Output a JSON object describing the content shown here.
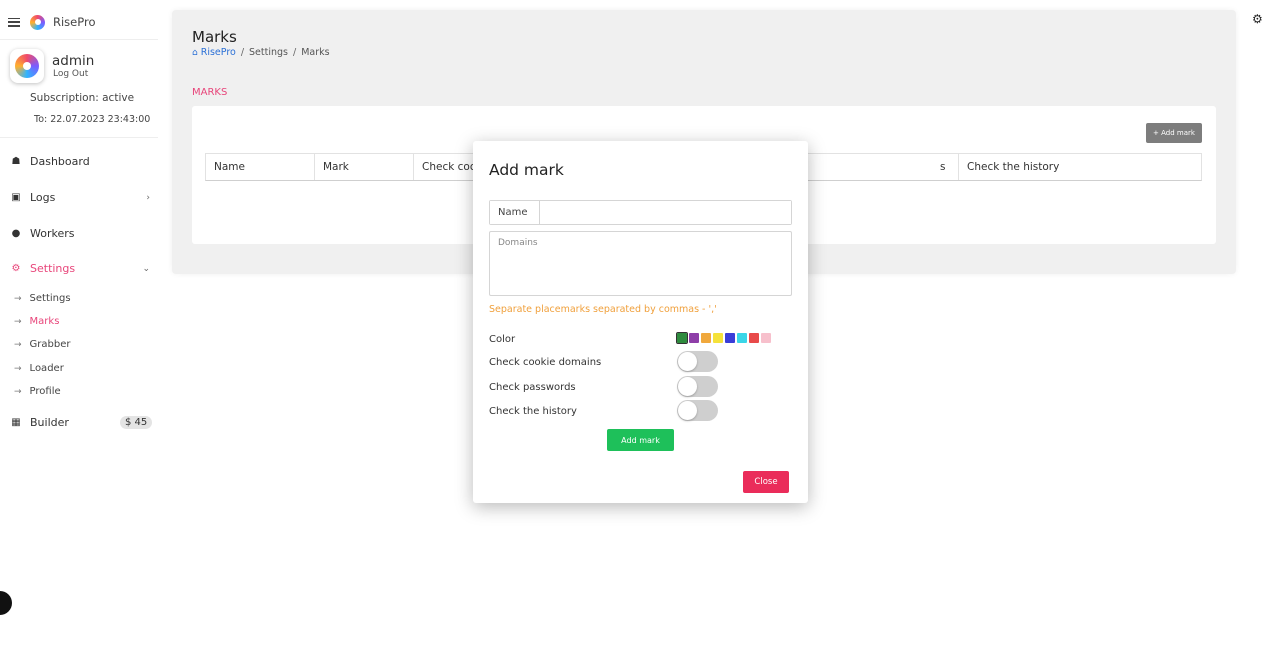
{
  "app": {
    "name": "RisePro"
  },
  "user": {
    "name": "admin",
    "logout_label": "Log Out",
    "subscription": "Subscription: active",
    "valid_to": "To: 22.07.2023 23:43:00"
  },
  "sidebar": {
    "items": [
      {
        "label": "Dashboard",
        "icon": "home-icon"
      },
      {
        "label": "Logs",
        "icon": "layers-icon"
      },
      {
        "label": "Workers",
        "icon": "users-icon"
      },
      {
        "label": "Settings",
        "icon": "gear-icon"
      },
      {
        "label": "Builder",
        "icon": "box-icon"
      }
    ],
    "settings_subitems": [
      "Settings",
      "Marks",
      "Grabber",
      "Loader",
      "Profile"
    ],
    "builder_badge": "$ 45",
    "accent_color": "#e8457a"
  },
  "page": {
    "title": "Marks",
    "breadcrumb": [
      "RisePro",
      "Settings",
      "Marks"
    ],
    "section_label": "MARKS",
    "add_button": "+ Add mark",
    "table_headers": [
      "Name",
      "Mark",
      "Check coo",
      "s",
      "Check the history"
    ]
  },
  "modal": {
    "title": "Add mark",
    "name_label": "Name",
    "name_value": "",
    "domains_placeholder": "Domains",
    "hint": "Separate placemarks separated by commas - ','",
    "color_label": "Color",
    "colors": [
      "#2e8b3e",
      "#8e3ea8",
      "#f0a83c",
      "#f5e23a",
      "#3a3ed8",
      "#3ad6e8",
      "#e84a4a",
      "#f7c0cc"
    ],
    "options": [
      "Check cookie domains",
      "Check passwords",
      "Check the history"
    ],
    "add_button": "Add mark",
    "close_button": "Close"
  }
}
